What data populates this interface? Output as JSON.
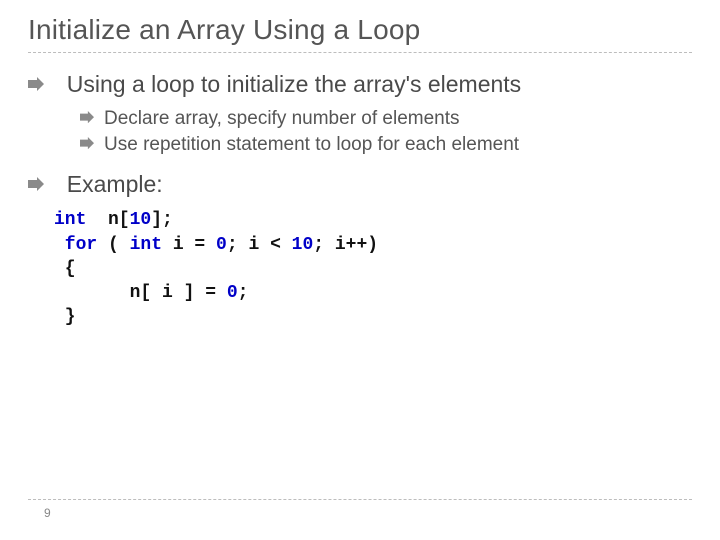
{
  "title": "Initialize an Array Using a Loop",
  "bullets": {
    "item1": "Using a loop to initialize the array's elements",
    "sub1": "Declare array, specify number of elements",
    "sub2": "Use repetition statement to loop for each element",
    "item2": "Example:"
  },
  "code": {
    "t_int": "int",
    "t_ndecl": "  n[",
    "t_10a": "10",
    "t_declend": "];",
    "t_for": " for",
    "t_open": " ( ",
    "t_int2": "int",
    "t_ieq": " i = ",
    "t_zero": "0",
    "t_semi1": "; i < ",
    "t_10b": "10",
    "t_inc": "; i++)",
    "t_lb": " {",
    "t_body1": "       n[ i ] = ",
    "t_zero2": "0",
    "t_bodyend": ";",
    "t_rb": " }"
  },
  "page": "9"
}
